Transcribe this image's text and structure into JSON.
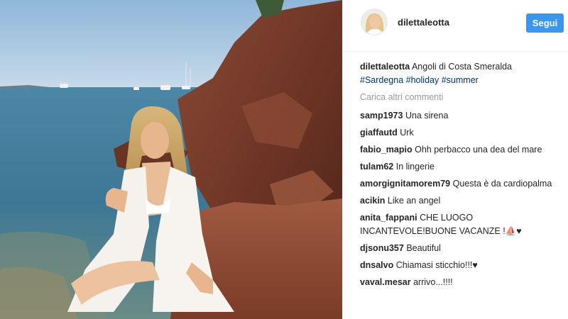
{
  "post": {
    "username": "dilettaleotta",
    "follow_label": "Segui"
  },
  "caption": {
    "username": "dilettaleotta",
    "text": "Angoli di Costa Smeralda",
    "hashtags": [
      "#Sardegna",
      "#holiday",
      "#summer"
    ]
  },
  "load_more_label": "Carica altri commenti",
  "comments": [
    {
      "user": "samp1973",
      "text": "Una sirena"
    },
    {
      "user": "giaffautd",
      "text": "Urk"
    },
    {
      "user": "fabio_mapio",
      "text": "Ohh perbacco una dea del mare"
    },
    {
      "user": "tulam62",
      "text": "In lingerie"
    },
    {
      "user": "amorgignitamorem79",
      "text": "Questa è da cardiopalma"
    },
    {
      "user": "acikin",
      "text": "Like an angel"
    },
    {
      "user": "anita_fappani",
      "text": "CHE LUOGO INCANTEVOLE!BUONE VACANZE !⛵♥"
    },
    {
      "user": "djsonu357",
      "text": "Beautiful"
    },
    {
      "user": "dnsalvo",
      "text": "Chiamasi sticchio!!!♥"
    },
    {
      "user": "vaval.mesar",
      "text": "arrivo...!!!!"
    }
  ],
  "colors": {
    "accent": "#3897f0",
    "hashtag": "#003569",
    "muted": "#999999"
  }
}
